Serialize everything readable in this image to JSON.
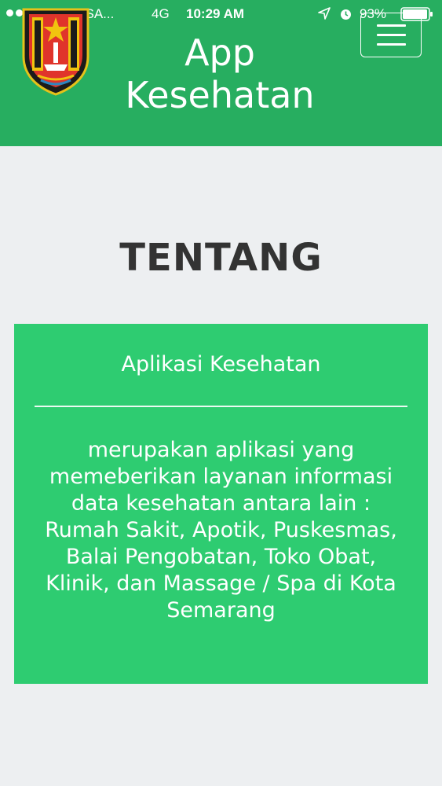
{
  "status_bar": {
    "carrier": "INDOSA...",
    "network": "4G",
    "time": "10:29 AM",
    "battery": "93%",
    "icons": [
      "signal-dots-icon",
      "location-arrow-icon",
      "alarm-clock-icon",
      "battery-icon"
    ]
  },
  "header": {
    "title_line1": "App",
    "title_line2": "Kesehatan",
    "menu_icon": "hamburger-menu-icon",
    "logo": "semarang-city-emblem"
  },
  "main": {
    "section_title": "TENTANG",
    "card": {
      "title": "Aplikasi Kesehatan",
      "description": "merupakan aplikasi yang memeberikan layanan informasi data kesehatan antara lain : Rumah Sakit, Apotik, Puskesmas, Balai Pengobatan, Toko Obat, Klinik, dan Massage / Spa di Kota Semarang"
    }
  },
  "colors": {
    "header_bg": "#27ae60",
    "card_bg": "#2ecc71",
    "page_bg": "#edeff1",
    "title_text": "#333333"
  }
}
